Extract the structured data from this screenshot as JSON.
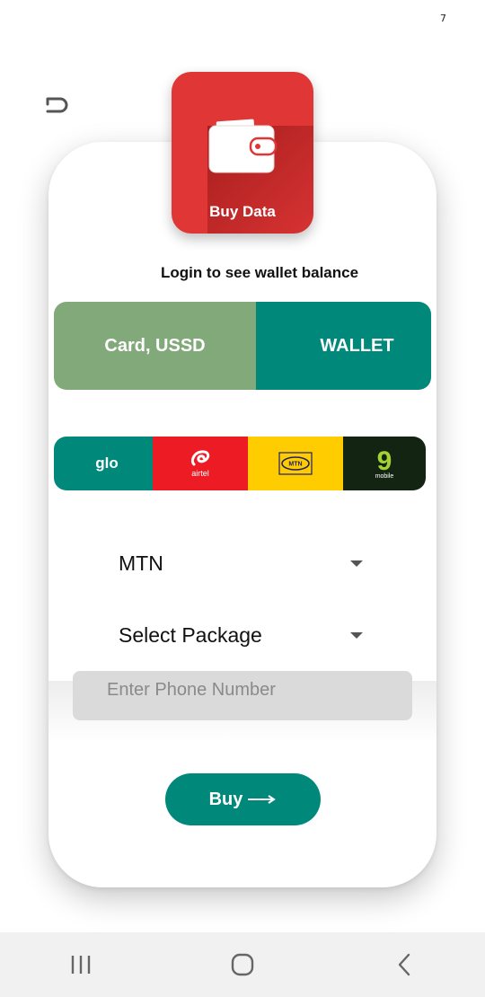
{
  "status": {
    "mark": "7"
  },
  "app_tile": {
    "label": "Buy Data"
  },
  "login_prompt": "Login to see wallet balance",
  "payment_methods": {
    "card_ussd_label": "Card, USSD",
    "wallet_label": "WALLET"
  },
  "networks": {
    "glo_label": "glo",
    "airtel_label": "airtel",
    "mtn_label": "MTN",
    "nine_mobile_number": "9",
    "nine_mobile_label": "mobile"
  },
  "form": {
    "network_value": "MTN",
    "package_value": "Select Package",
    "phone_placeholder": "Enter Phone Number",
    "buy_label": "Buy"
  },
  "colors": {
    "teal": "#00897b",
    "green": "#82a979",
    "red": "#e03636"
  }
}
